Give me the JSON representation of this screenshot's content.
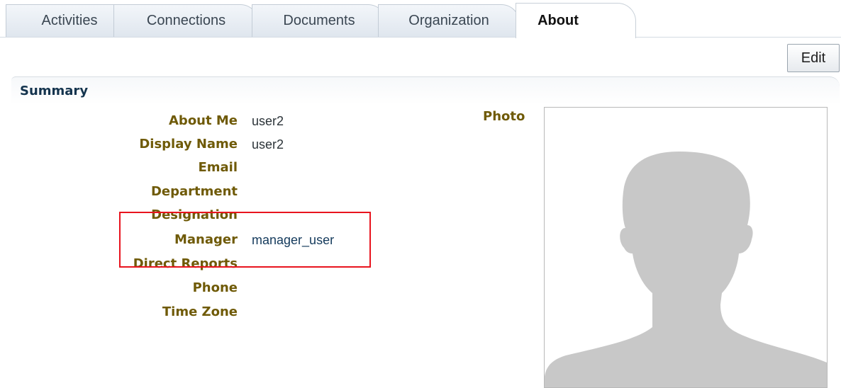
{
  "tabs": [
    {
      "label": "Activities",
      "active": false
    },
    {
      "label": "Connections",
      "active": false
    },
    {
      "label": "Documents",
      "active": false
    },
    {
      "label": "Organization",
      "active": false
    },
    {
      "label": "About",
      "active": true
    }
  ],
  "toolbar": {
    "edit_label": "Edit"
  },
  "summary": {
    "title": "Summary",
    "fields": [
      {
        "label": "About Me",
        "value": "user2"
      },
      {
        "label": "Display Name",
        "value": "user2"
      },
      {
        "label": "Email",
        "value": ""
      },
      {
        "label": "Department",
        "value": ""
      },
      {
        "label": "Designation",
        "value": ""
      },
      {
        "label": "Manager",
        "value": "manager_user"
      },
      {
        "label": "Direct Reports",
        "value": ""
      },
      {
        "label": "Phone",
        "value": ""
      },
      {
        "label": "Time Zone",
        "value": ""
      }
    ],
    "photo_label": "Photo",
    "photo_icon": "avatar-silhouette-icon"
  },
  "colors": {
    "label": "#6f5a07",
    "title": "#14344e",
    "highlight": "#e8141e",
    "silhouette": "#c8c8c8"
  }
}
